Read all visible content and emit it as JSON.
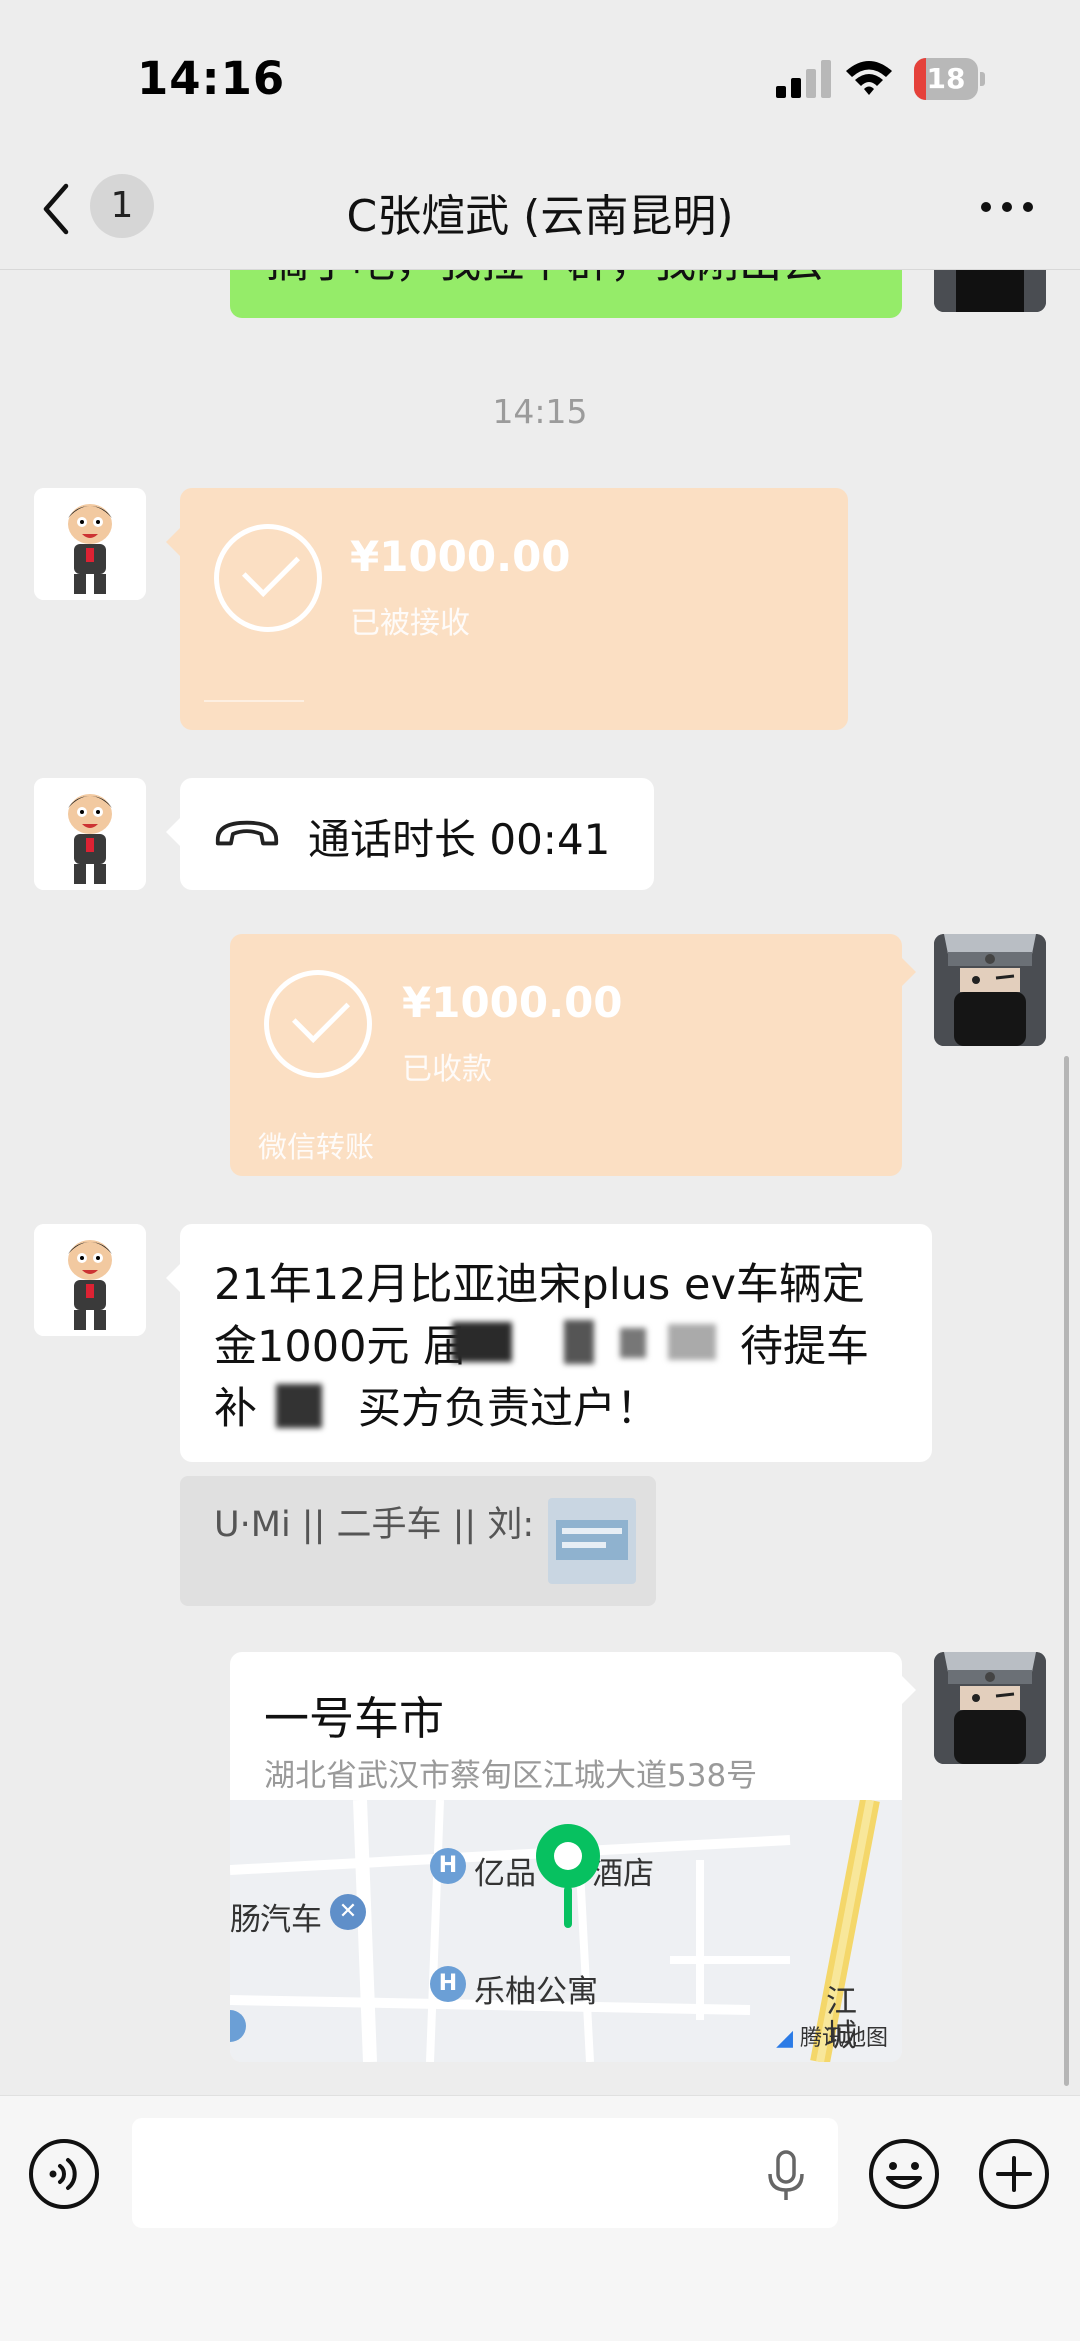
{
  "status_bar": {
    "time": "14:16",
    "battery_level": "18",
    "battery_fraction": 0.18,
    "battery_color": "#e5413a",
    "icons": [
      "signal-icon",
      "wifi-icon",
      "battery-icon"
    ]
  },
  "nav": {
    "back_icon": "chevron-left-icon",
    "unread_count": "1",
    "title": "C张煊武 (云南昆明)",
    "more_icon": "more-horizontal-icon"
  },
  "messages": {
    "top_partial": {
      "text": "搞了吧，我拉个群，我刚出去",
      "bubble_color": "#95ec69"
    },
    "timestamp": "14:15",
    "transfer_received": {
      "amount": "¥1000.00",
      "status": "已被接收",
      "bubble_color": "#fbdfc3"
    },
    "call": {
      "icon": "phone-hangup-icon",
      "text": "通话时长 00:41"
    },
    "transfer_sent": {
      "amount": "¥1000.00",
      "status": "已收款",
      "footer": "微信转账"
    },
    "text_message": {
      "line1": "21年12月比亚迪宋plus ev车辆定",
      "line2": "金1000元  届",
      "line2_end": "待提车",
      "line3_start": "补",
      "line3_mid": "买方负责过户！"
    },
    "quote": {
      "text": "U·Mi || 二手车 || 刘:"
    },
    "location": {
      "title": "一号车市",
      "address": "湖北省武汉市蔡甸区江城大道538号",
      "map_labels": {
        "hotel": "亿品",
        "hotel_suffix": "酒店",
        "apartment": "乐柚公寓",
        "car": "汽车",
        "car_prefix": "肠",
        "road": "江",
        "road2": "城",
        "credit": "腾讯地图"
      },
      "pin_color": "#07c160"
    }
  },
  "input_bar": {
    "voice_icon": "voice-icon",
    "mic_icon": "microphone-icon",
    "emoji_icon": "emoji-icon",
    "plus_icon": "plus-icon",
    "message_value": ""
  }
}
